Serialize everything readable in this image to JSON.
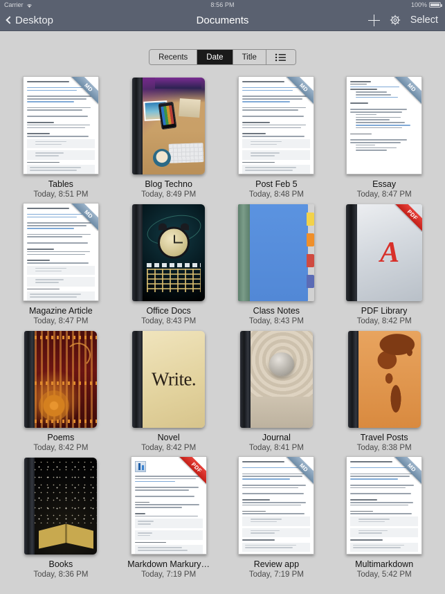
{
  "status_bar": {
    "carrier": "Carrier",
    "wifi_icon": "wifi-icon",
    "time": "8:56 PM",
    "battery_percent": "100%",
    "battery_icon": "battery-full-icon"
  },
  "nav_bar": {
    "back_label": "Desktop",
    "back_icon": "chevron-left-icon",
    "title": "Documents",
    "add_icon": "plus-icon",
    "settings_icon": "gear-icon",
    "select_label": "Select"
  },
  "segmented_control": {
    "options": [
      {
        "label": "Recents",
        "selected": false
      },
      {
        "label": "Date",
        "selected": true
      },
      {
        "label": "Title",
        "selected": false
      }
    ],
    "view_toggle_icon": "list-view-icon"
  },
  "colors": {
    "nav_bar": "#5a6170",
    "page_background": "#d2d2d2",
    "selected_segment": "#1a1a1a",
    "md_badge": "#7d99b3",
    "pdf_badge": "#d8302a"
  },
  "documents": [
    {
      "name": "Tables",
      "date": "Today, 8:51 PM",
      "badge": "MD",
      "thumb": "markdown-page"
    },
    {
      "name": "Blog Techno",
      "date": "Today, 8:49 PM",
      "badge": "",
      "thumb": "techno-desk-book"
    },
    {
      "name": "Post Feb 5",
      "date": "Today, 8:48 PM",
      "badge": "MD",
      "thumb": "markdown-page"
    },
    {
      "name": "Essay",
      "date": "Today, 8:47 PM",
      "badge": "MD",
      "thumb": "markdown-page-sparse"
    },
    {
      "name": "Magazine Article",
      "date": "Today, 8:47 PM",
      "badge": "MD",
      "thumb": "markdown-page"
    },
    {
      "name": "Office Docs",
      "date": "Today, 8:43 PM",
      "badge": "",
      "thumb": "clock-calendar-book"
    },
    {
      "name": "Class Notes",
      "date": "Today, 8:43 PM",
      "badge": "",
      "thumb": "blue-tabbed-binder"
    },
    {
      "name": "PDF Library",
      "date": "Today, 8:42 PM",
      "badge": "PDF",
      "thumb": "acrobat-book"
    },
    {
      "name": "Poems",
      "date": "Today, 8:42 PM",
      "badge": "",
      "thumb": "ornate-maroon-book"
    },
    {
      "name": "Novel",
      "date": "Today, 8:42 PM",
      "badge": "",
      "thumb": "write-parchment-book"
    },
    {
      "name": "Journal",
      "date": "Today, 8:41 PM",
      "badge": "",
      "thumb": "zen-sand-stone-book"
    },
    {
      "name": "Travel Posts",
      "date": "Today, 8:38 PM",
      "badge": "",
      "thumb": "world-map-book"
    },
    {
      "name": "Books",
      "date": "Today, 8:36 PM",
      "badge": "",
      "thumb": "open-book-letters"
    },
    {
      "name": "Markdown Markury…",
      "date": "Today, 7:19 PM",
      "badge": "PDF",
      "thumb": "pdf-page"
    },
    {
      "name": "Review app",
      "date": "Today, 7:19 PM",
      "badge": "MD",
      "thumb": "markdown-page"
    },
    {
      "name": "Multimarkdown",
      "date": "Today, 5:42 PM",
      "badge": "MD",
      "thumb": "markdown-page"
    }
  ]
}
